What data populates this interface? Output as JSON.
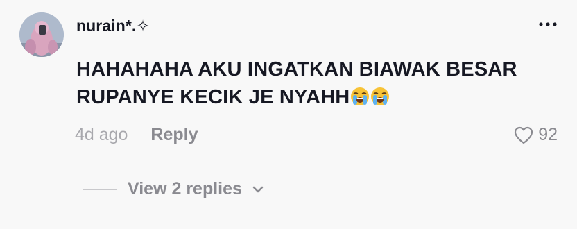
{
  "comment": {
    "avatar_icon": "avatar-image",
    "username": "nurain*.✧",
    "text_line1": "HAHAHAHA AKU INGATKAN BIAWAK BESAR",
    "text_line2": "RUPANYE KECIK JE NYAHH",
    "emojis": [
      "loudly-crying-face",
      "loudly-crying-face"
    ],
    "timestamp": "4d ago",
    "reply_label": "Reply",
    "like_count": "92",
    "like_icon": "heart-outline-icon",
    "more_icon": "more-dots-icon",
    "view_replies_label": "View 2 replies",
    "view_replies_icon": "chevron-down-icon"
  },
  "colors": {
    "background": "#f8f8f8",
    "text_primary": "#161823",
    "text_muted": "#8a8a90",
    "timestamp": "#a8a8ad"
  }
}
